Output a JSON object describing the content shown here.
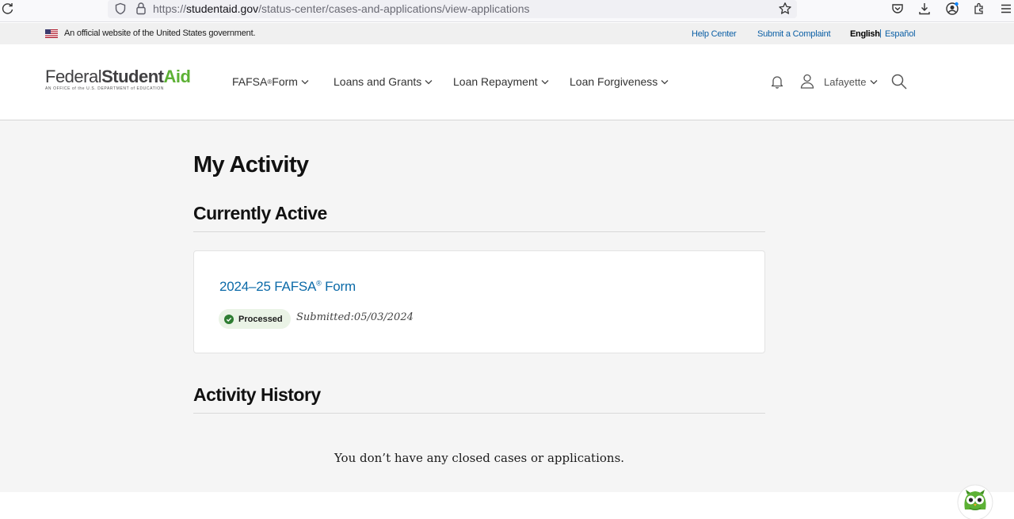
{
  "browser": {
    "url_prefix": "https://",
    "url_host": "studentaid.gov",
    "url_path": "/status-center/cases-and-applications/view-applications"
  },
  "gov_banner": {
    "text": "An official website of the United States government.",
    "help_center": "Help Center",
    "submit_complaint": "Submit a Complaint",
    "english": "English",
    "separator": "|",
    "espanol": "Español"
  },
  "header": {
    "logo_federal": "Federal",
    "logo_student": "Student",
    "logo_aid": "Aid",
    "logo_tagline": "AN OFFICE of the U.S. DEPARTMENT of EDUCATION",
    "nav": {
      "fafsa": "FAFSA",
      "fafsa_reg": "®",
      "fafsa_form": " Form",
      "loans_grants": "Loans and Grants",
      "loan_repayment": "Loan Repayment",
      "loan_forgiveness": "Loan Forgiveness"
    },
    "user_name": "Lafayette"
  },
  "main": {
    "page_title": "My Activity",
    "currently_active_title": "Currently Active",
    "card": {
      "link_prefix": "2024–25 FAFSA",
      "link_reg": "®",
      "link_suffix": " Form",
      "status": "Processed",
      "submitted": "Submitted:05/03/2024"
    },
    "history_title": "Activity History",
    "empty_message": "You don’t have any closed cases or applications."
  },
  "colors": {
    "brand_green": "#5db135",
    "link_blue": "#0b6aa8",
    "status_green": "#2e7d32"
  }
}
